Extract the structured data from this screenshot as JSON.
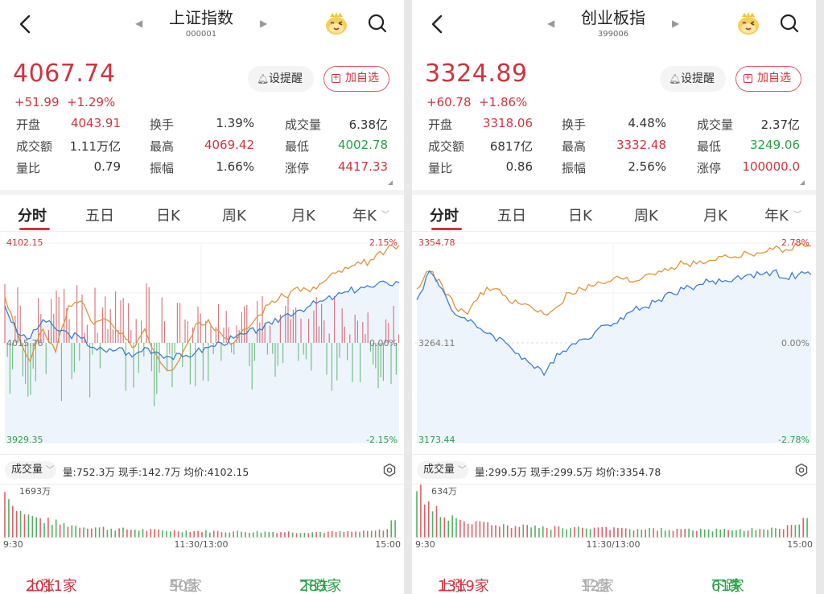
{
  "panels": [
    {
      "title": "上证指数",
      "code": "000001",
      "price": "4067.74",
      "change": "+51.99",
      "change_pct": "+1.29%",
      "remind_label": "设提醒",
      "add_label": "加自选",
      "stats": [
        [
          "开盘",
          "4043.91",
          "red",
          "换手",
          "1.39%",
          "",
          "成交量",
          "6.38亿",
          ""
        ],
        [
          "成交额",
          "1.11万亿",
          "",
          "最高",
          "4069.42",
          "red",
          "最低",
          "4002.78",
          "green"
        ],
        [
          "量比",
          "0.79",
          "",
          "振幅",
          "1.66%",
          "",
          "涨停",
          "4417.33",
          "red"
        ]
      ],
      "tabs": [
        "分时",
        "五日",
        "日K",
        "周K",
        "月K",
        "年K"
      ],
      "axis": {
        "top": "4102.15",
        "mid": "4015.76",
        "bottom": "3929.35",
        "top_pct": "2.15%",
        "mid_pct": "0.00%",
        "bottom_pct": "-2.15%"
      },
      "volume_selector": "成交量",
      "volume_info": "量:752.3万  现手:142.7万  均价:4102.15",
      "volume_max": "1693万",
      "time_labels": [
        "9:30",
        "11:30/13:00",
        "15:00"
      ],
      "breadth": {
        "up_label": "上涨",
        "up": "2011家",
        "flat_label": "平盘",
        "flat": "50家",
        "down_label": "下跌",
        "down": "283家"
      },
      "chart_data": {
        "type": "line",
        "range_pct": [
          -2.15,
          2.15
        ],
        "price_series_pct": [
          1.0,
          0.2,
          -0.4,
          0.3,
          -0.2,
          0.8,
          0.9,
          0.4,
          0.5,
          0.2,
          -0.1,
          0.3,
          -0.3,
          -0.6,
          -0.2,
          0.4,
          0.5,
          0.2,
          0.0,
          0.3,
          0.6,
          0.9,
          1.0,
          1.2,
          1.1,
          1.3,
          1.5,
          1.6,
          1.7,
          1.8,
          2.0,
          2.1
        ],
        "avg_series_pct": [
          0.8,
          0.2,
          0.1,
          0.5,
          0.3,
          0.2,
          0.1,
          -0.1,
          -0.2,
          -0.1,
          -0.3,
          -0.1,
          -0.2,
          -0.3,
          -0.3,
          -0.2,
          -0.1,
          0.0,
          0.1,
          0.2,
          0.3,
          0.4,
          0.6,
          0.7,
          0.8,
          0.9,
          1.0,
          1.1,
          1.2,
          1.2,
          1.3,
          1.3
        ]
      },
      "volume_data": [
        1693,
        1200,
        950,
        800,
        700,
        620,
        560,
        500,
        470,
        430,
        400,
        380,
        360,
        340,
        320,
        310,
        300,
        290,
        280,
        270,
        265,
        260,
        255,
        250,
        245,
        240,
        235,
        230,
        228,
        225,
        222,
        220,
        218,
        215,
        212,
        210,
        208,
        205,
        205,
        205,
        206,
        208,
        210,
        212,
        215,
        220,
        230,
        260,
        320,
        600
      ]
    },
    {
      "title": "创业板指",
      "code": "399006",
      "price": "3324.89",
      "change": "+60.78",
      "change_pct": "+1.86%",
      "remind_label": "设提醒",
      "add_label": "加自选",
      "stats": [
        [
          "开盘",
          "3318.06",
          "red",
          "换手",
          "4.48%",
          "",
          "成交量",
          "2.37亿",
          ""
        ],
        [
          "成交额",
          "6817亿",
          "",
          "最高",
          "3332.48",
          "red",
          "最低",
          "3249.06",
          "green"
        ],
        [
          "量比",
          "0.86",
          "",
          "振幅",
          "2.56%",
          "",
          "涨停",
          "100000.0",
          "red"
        ]
      ],
      "tabs": [
        "分时",
        "五日",
        "日K",
        "周K",
        "月K",
        "年K"
      ],
      "axis": {
        "top": "3354.78",
        "mid": "3264.11",
        "bottom": "3173.44",
        "top_pct": "2.78%",
        "mid_pct": "0.00%",
        "bottom_pct": "-2.78%"
      },
      "volume_selector": "成交量",
      "volume_info": "量:299.5万  现手:299.5万  均价:3354.78",
      "volume_max": "634万",
      "time_labels": [
        "9:30",
        "11:30/13:00",
        "15:00"
      ],
      "breadth": {
        "up_label": "上涨",
        "up": "1319家",
        "flat_label": "平盘",
        "flat": "12家",
        "down_label": "下跌",
        "down": "61家"
      },
      "chart_data": {
        "type": "line",
        "range_pct": [
          -2.78,
          2.78
        ],
        "price_series_pct": [
          1.5,
          2.0,
          1.6,
          1.0,
          0.8,
          1.4,
          1.5,
          1.3,
          1.1,
          1.0,
          0.8,
          1.0,
          1.4,
          1.5,
          1.6,
          1.7,
          1.8,
          1.7,
          1.9,
          2.0,
          2.1,
          2.2,
          2.2,
          2.3,
          2.4,
          2.4,
          2.5,
          2.5,
          2.6,
          2.6,
          2.7,
          2.7
        ],
        "avg_series_pct": [
          1.2,
          2.0,
          1.5,
          0.8,
          0.6,
          0.4,
          0.2,
          0.0,
          -0.3,
          -0.6,
          -0.9,
          -0.3,
          -0.1,
          0.1,
          0.3,
          0.5,
          0.7,
          0.9,
          1.0,
          1.2,
          1.4,
          1.5,
          1.6,
          1.7,
          1.7,
          1.8,
          1.9,
          1.9,
          2.0,
          1.8,
          1.9,
          1.9
        ]
      },
      "volume_data": [
        634,
        480,
        380,
        320,
        280,
        250,
        230,
        210,
        195,
        185,
        175,
        168,
        160,
        155,
        150,
        145,
        140,
        138,
        135,
        132,
        130,
        128,
        126,
        124,
        122,
        120,
        118,
        116,
        115,
        114,
        113,
        112,
        111,
        110,
        109,
        108,
        108,
        108,
        109,
        110,
        111,
        112,
        114,
        116,
        118,
        122,
        130,
        150,
        190,
        310
      ]
    }
  ],
  "colors": {
    "up": "#d0343e",
    "down": "#2aa046",
    "price_line": "#e0943a",
    "avg_line": "#3b7fd0",
    "fill": "#eef4fc"
  }
}
